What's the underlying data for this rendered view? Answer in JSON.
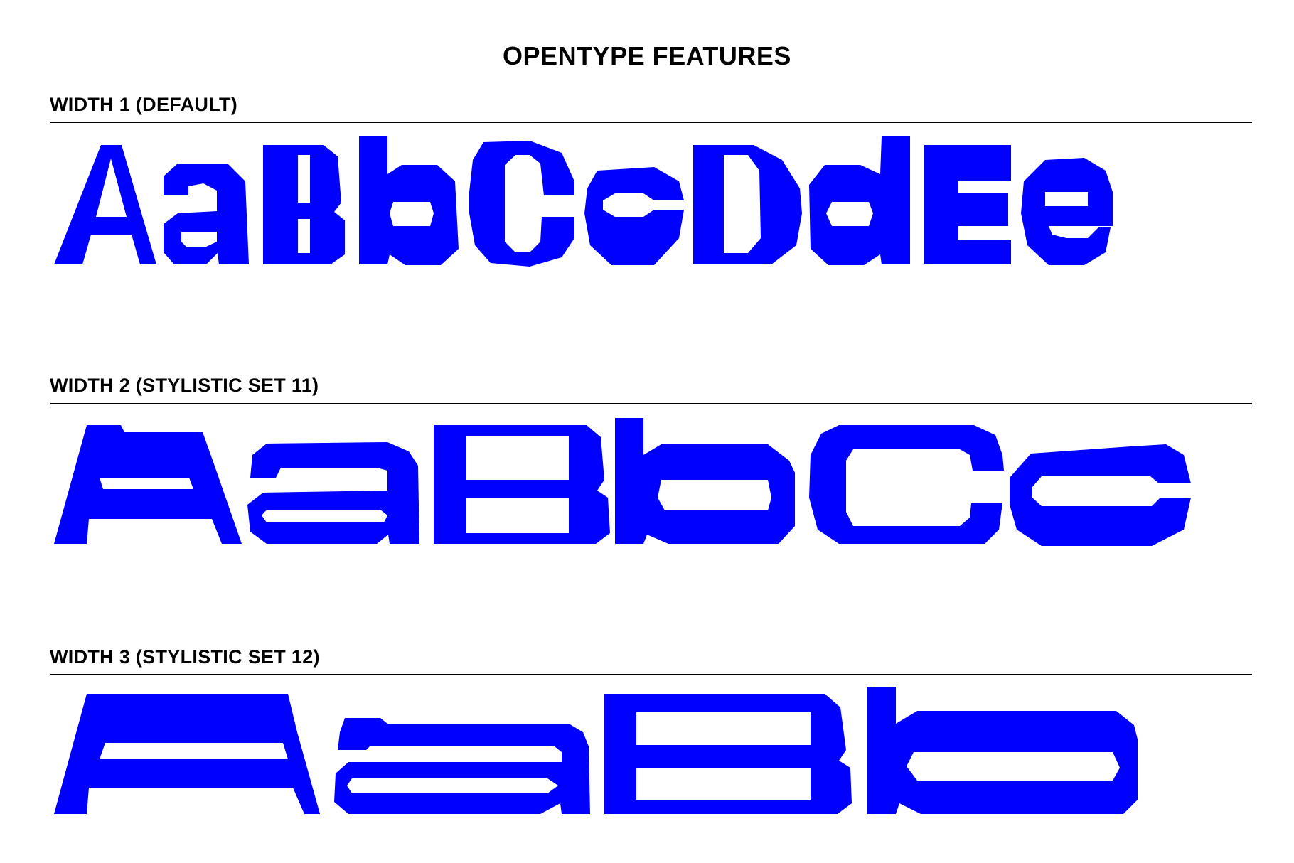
{
  "title": "OPENTYPE FEATURES",
  "colors": {
    "glyph": "#0000ff",
    "text": "#000000",
    "background": "#ffffff"
  },
  "sections": [
    {
      "label": "WIDTH 1 (DEFAULT)",
      "specimen": "AaBbCcDdEe"
    },
    {
      "label": "WIDTH 2 (STYLISTIC SET 11)",
      "specimen": "AaBbCc"
    },
    {
      "label": "WIDTH 3 (STYLISTIC SET 12)",
      "specimen": "AaBb"
    }
  ]
}
